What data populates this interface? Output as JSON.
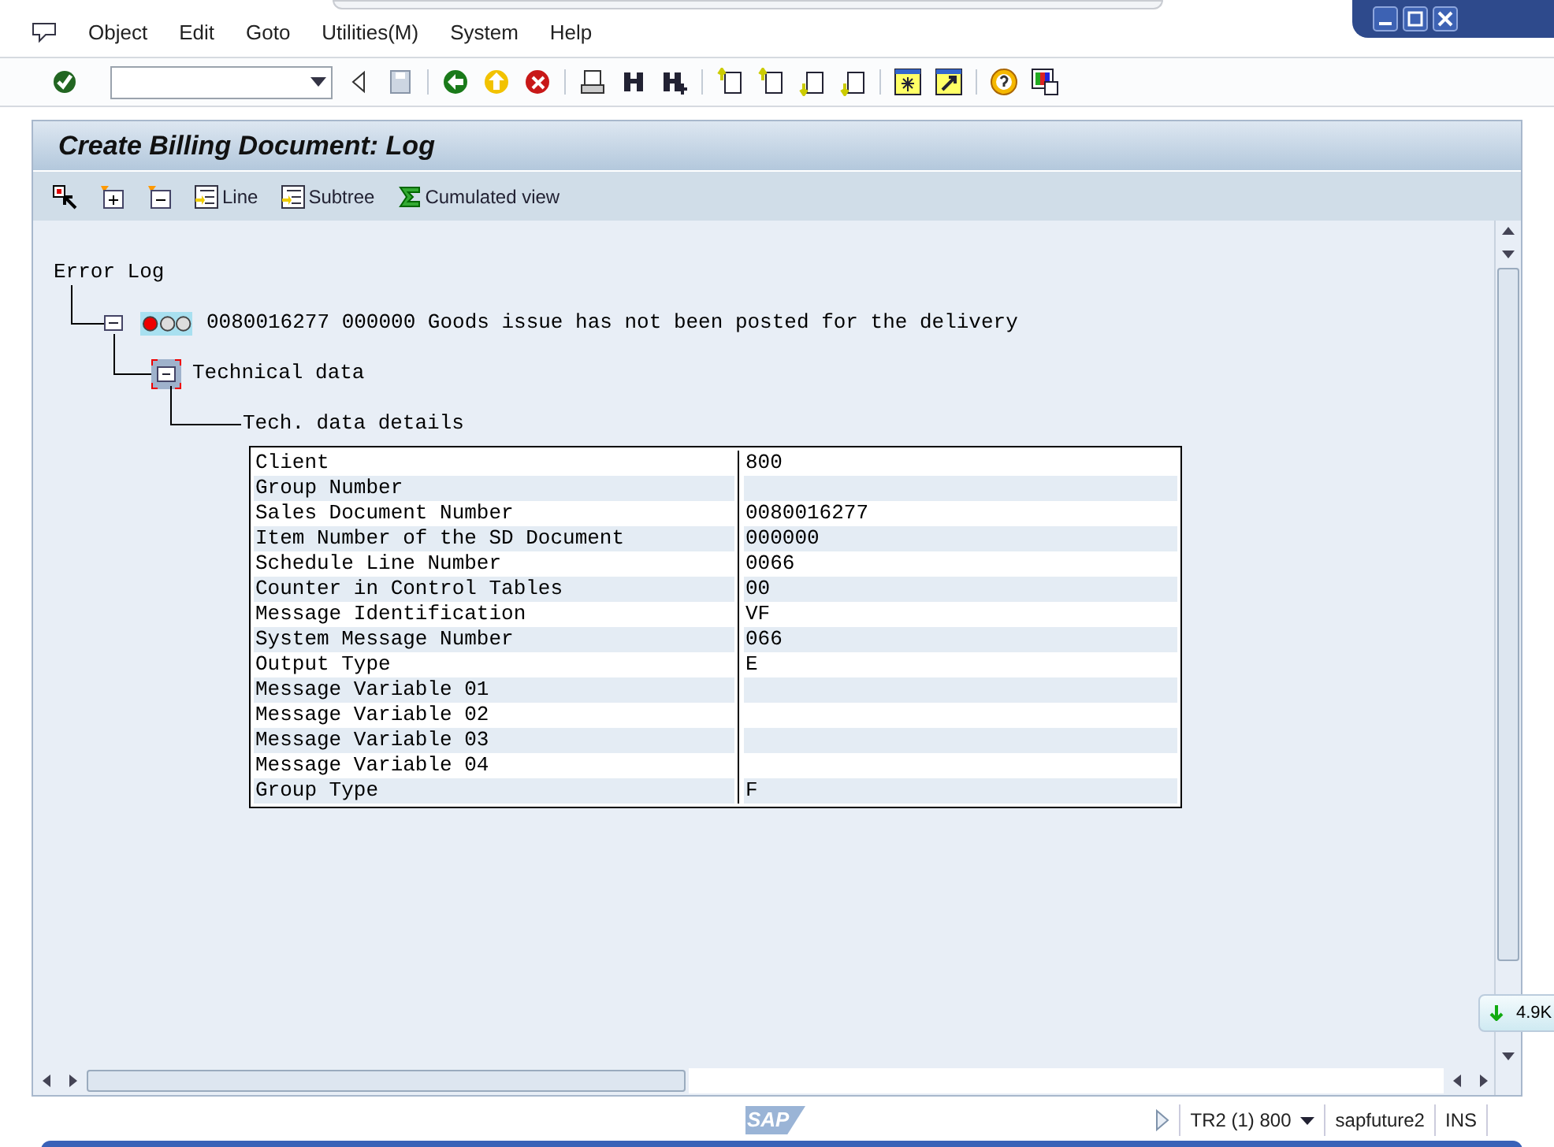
{
  "menu": [
    "Object",
    "Edit",
    "Goto",
    "Utilities(M)",
    "System",
    "Help"
  ],
  "screen_title": "Create Billing Document: Log",
  "app_toolbar": [
    {
      "kind": "select"
    },
    {
      "kind": "expand"
    },
    {
      "kind": "collapse"
    },
    {
      "label": "Line",
      "kind": "line"
    },
    {
      "label": "Subtree",
      "kind": "subtree"
    },
    {
      "label": "Cumulated view",
      "kind": "sum"
    }
  ],
  "tree": {
    "root": "Error Log",
    "message": {
      "text": "0080016277 000000 Goods issue has not been posted for the delivery",
      "kind": "error",
      "expanded": true
    },
    "node": {
      "text": "Technical data",
      "expanded": true,
      "selected": true
    },
    "leaf": "Tech. data details"
  },
  "table": {
    "rows": [
      [
        "Client",
        "800"
      ],
      [
        "Group Number",
        ""
      ],
      [
        "Sales Document Number",
        "0080016277"
      ],
      [
        "Item Number of the SD Document",
        "000000"
      ],
      [
        "Schedule Line Number",
        "0066"
      ],
      [
        "Counter in Control Tables",
        "00"
      ],
      [
        "Message Identification",
        "VF"
      ],
      [
        "System Message Number",
        "066"
      ],
      [
        "Output Type",
        "E"
      ],
      [
        "Message Variable 01",
        ""
      ],
      [
        "Message Variable 02",
        ""
      ],
      [
        "Message Variable 03",
        ""
      ],
      [
        "Message Variable 04",
        ""
      ],
      [
        "Group Type",
        "F"
      ]
    ]
  },
  "download_badge": "4.9K",
  "logo": "SAP",
  "status_bar": {
    "system": "TR2 (1) 800",
    "server": "sapfuture2",
    "mode": "INS"
  }
}
